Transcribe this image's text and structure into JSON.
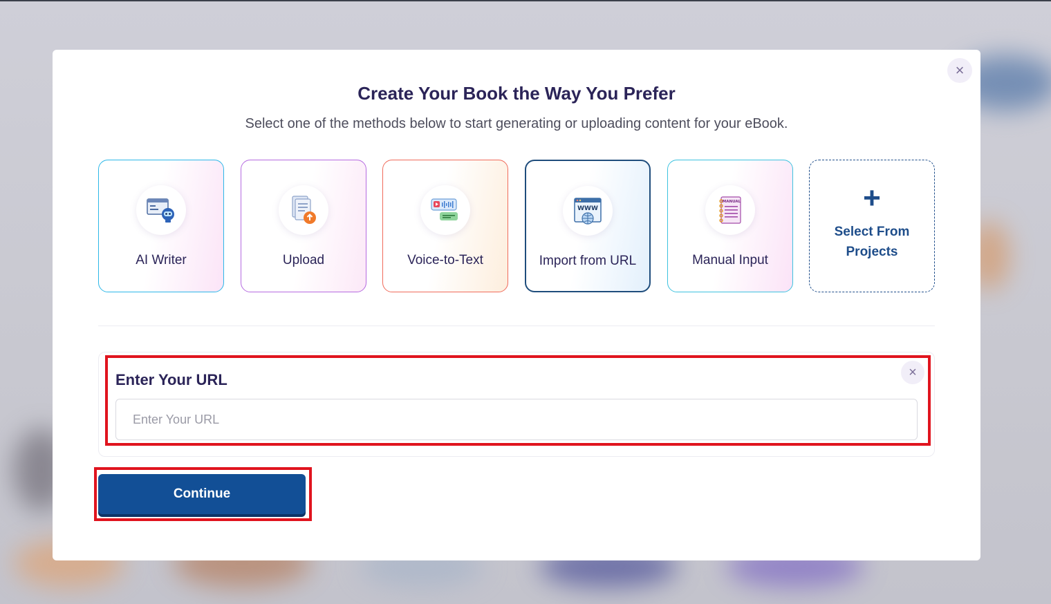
{
  "modal": {
    "title": "Create Your Book the Way You Prefer",
    "subtitle": "Select one of the methods below to start generating or uploading content for your eBook.",
    "close_symbol": "×"
  },
  "methods": [
    {
      "label": "AI Writer",
      "icon": "robot-writer-icon"
    },
    {
      "label": "Upload",
      "icon": "document-upload-icon"
    },
    {
      "label": "Voice-to-Text",
      "icon": "voice-chat-icon"
    },
    {
      "label": "Import from URL",
      "icon": "www-globe-icon",
      "selected": true
    },
    {
      "label": "Manual Input",
      "icon": "manual-notebook-icon",
      "icon_text": "MANUAL"
    },
    {
      "label": "Select From Projects",
      "icon": "plus-icon"
    }
  ],
  "url_section": {
    "title": "Enter Your URL",
    "placeholder": "Enter Your URL",
    "value": "",
    "close_symbol": "×"
  },
  "actions": {
    "continue_label": "Continue"
  },
  "colors": {
    "primary": "#124f96",
    "title": "#2b2458",
    "highlight": "#e0141e"
  }
}
